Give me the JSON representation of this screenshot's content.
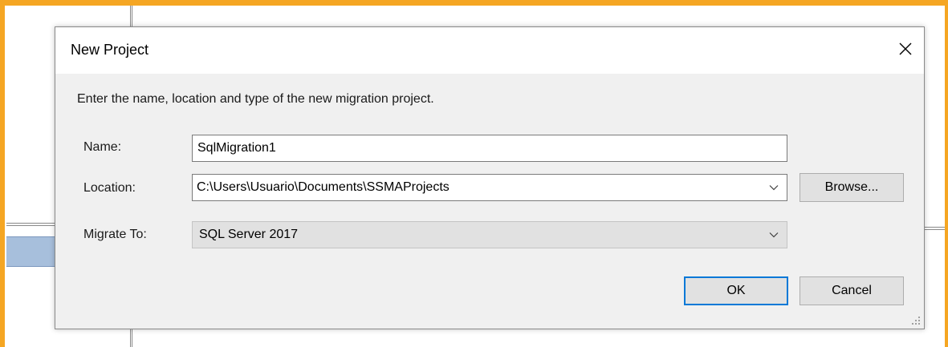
{
  "dialog": {
    "title": "New Project",
    "close_icon": "close-icon",
    "instructions": "Enter the name, location and type of the new migration project.",
    "name": {
      "label": "Name:",
      "value": "SqlMigration1"
    },
    "location": {
      "label": "Location:",
      "value": "C:\\Users\\Usuario\\Documents\\SSMAProjects",
      "browse_label": "Browse..."
    },
    "migrate_to": {
      "label": "Migrate To:",
      "value": "SQL Server 2017"
    },
    "ok_label": "OK",
    "cancel_label": "Cancel"
  },
  "colors": {
    "highlight_frame": "#f5a623",
    "dialog_background": "#f0f0f0",
    "default_button_border": "#0078d7",
    "background_selection": "#a7bfdc"
  }
}
